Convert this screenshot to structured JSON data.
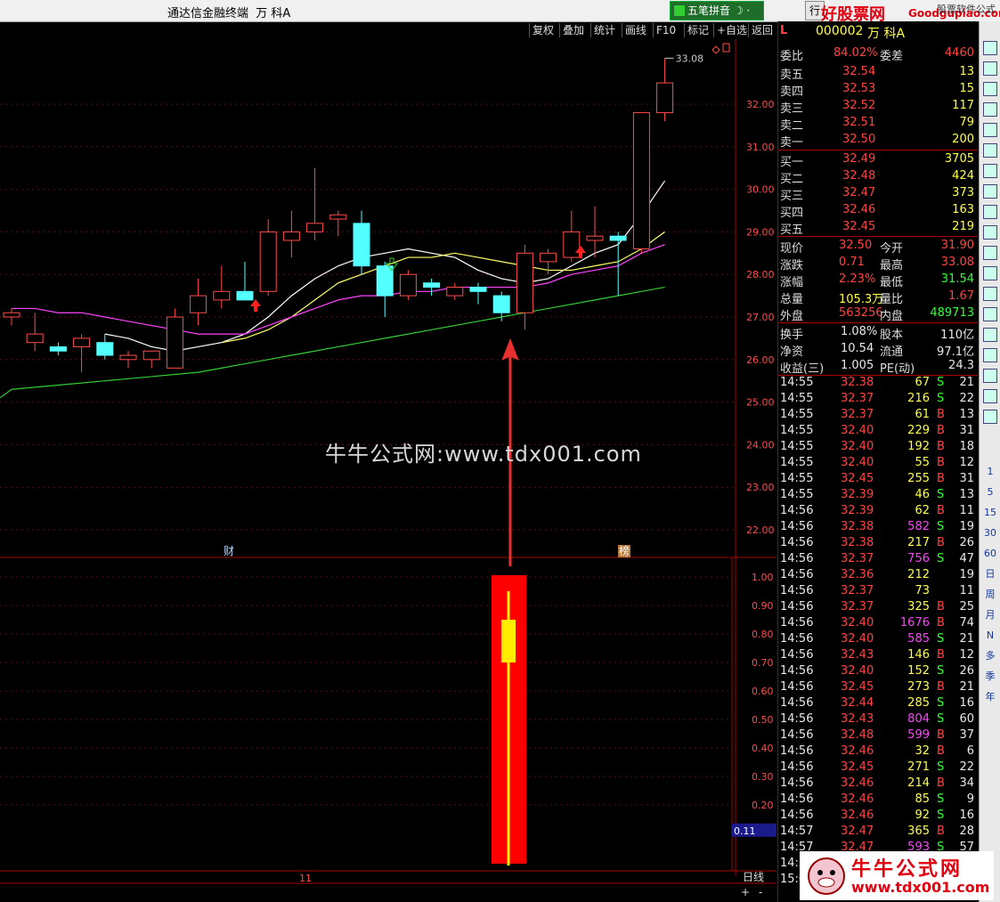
{
  "window": {
    "title": "通达信金融终端",
    "stock_name": "万 科A"
  },
  "top_right": {
    "formula_btn": "五笔拼音",
    "hang_label": "行",
    "brand": "好股票网",
    "brand_url": "Goodgupiao.com",
    "brand_sub": "股票软件公式"
  },
  "toolbar": {
    "items": [
      "复权",
      "叠加",
      "统计",
      "画线",
      "F10",
      "标记",
      "+自选",
      "返回"
    ]
  },
  "chart_data": [
    {
      "type": "candlestick",
      "title": "",
      "ylim": [
        21.5,
        33.3
      ],
      "yticks": [
        22.0,
        23.0,
        24.0,
        25.0,
        26.0,
        27.0,
        28.0,
        29.0,
        30.0,
        31.0,
        32.0
      ],
      "max_label": "33.08",
      "candles": [
        [
          27.0,
          27.2,
          26.8,
          27.1
        ],
        [
          26.4,
          27.1,
          26.2,
          26.6
        ],
        [
          26.3,
          26.4,
          26.1,
          26.2
        ],
        [
          26.3,
          26.6,
          25.7,
          26.5
        ],
        [
          26.4,
          26.6,
          26.0,
          26.1
        ],
        [
          26.0,
          26.2,
          25.8,
          26.1
        ],
        [
          26.0,
          26.2,
          25.8,
          26.2
        ],
        [
          25.8,
          27.2,
          25.8,
          27.0
        ],
        [
          27.1,
          27.9,
          26.8,
          27.5
        ],
        [
          27.4,
          28.2,
          27.2,
          27.6
        ],
        [
          27.6,
          28.3,
          27.5,
          27.4
        ],
        [
          27.6,
          29.3,
          27.5,
          29.0
        ],
        [
          28.8,
          29.5,
          28.4,
          29.0
        ],
        [
          29.0,
          30.5,
          28.8,
          29.2
        ],
        [
          29.3,
          29.5,
          28.9,
          29.4
        ],
        [
          29.2,
          29.5,
          28.0,
          28.2
        ],
        [
          28.2,
          28.3,
          27.0,
          27.5
        ],
        [
          27.5,
          28.1,
          27.4,
          28.0
        ],
        [
          27.8,
          27.9,
          27.5,
          27.7
        ],
        [
          27.5,
          27.8,
          27.4,
          27.7
        ],
        [
          27.7,
          27.8,
          27.3,
          27.6
        ],
        [
          27.5,
          27.6,
          26.9,
          27.1
        ],
        [
          27.1,
          28.7,
          26.7,
          28.5
        ],
        [
          28.3,
          28.6,
          28.0,
          28.5
        ],
        [
          28.4,
          29.5,
          28.3,
          29.0
        ],
        [
          28.8,
          29.6,
          28.4,
          28.9
        ],
        [
          28.9,
          29.0,
          27.5,
          28.8
        ],
        [
          28.6,
          31.8,
          28.5,
          31.8
        ],
        [
          31.8,
          33.08,
          31.6,
          32.5
        ]
      ],
      "ma_series": [
        {
          "color": "#ffffff",
          "values": [
            null,
            null,
            null,
            null,
            26.6,
            26.5,
            26.3,
            26.2,
            26.3,
            26.4,
            26.6,
            27.0,
            27.5,
            27.9,
            28.2,
            28.4,
            28.5,
            28.6,
            28.5,
            28.4,
            28.1,
            27.9,
            27.8,
            27.9,
            28.2,
            28.5,
            28.7,
            29.4,
            30.2
          ]
        },
        {
          "color": "#ffff66",
          "values": [
            null,
            null,
            null,
            null,
            null,
            null,
            null,
            null,
            null,
            26.4,
            26.5,
            26.7,
            27.0,
            27.4,
            27.8,
            28.0,
            28.2,
            28.4,
            28.4,
            28.5,
            28.4,
            28.3,
            28.2,
            28.1,
            28.1,
            28.2,
            28.3,
            28.6,
            29.0
          ]
        },
        {
          "color": "#ff44ff",
          "values": [
            27.2,
            27.2,
            27.1,
            27.1,
            27.0,
            26.9,
            26.8,
            26.7,
            26.6,
            26.6,
            26.6,
            26.8,
            27.0,
            27.2,
            27.4,
            27.5,
            27.5,
            27.6,
            27.6,
            27.7,
            27.7,
            27.7,
            27.7,
            27.8,
            28.0,
            28.1,
            28.2,
            28.5,
            28.7
          ]
        },
        {
          "color": "#33cc33",
          "values": [
            25.3,
            25.35,
            25.4,
            25.45,
            25.5,
            25.55,
            25.6,
            25.65,
            25.7,
            25.8,
            25.9,
            26.0,
            26.1,
            26.2,
            26.3,
            26.4,
            26.5,
            26.6,
            26.7,
            26.8,
            26.9,
            27.0,
            27.1,
            27.2,
            27.3,
            27.4,
            27.5,
            27.6,
            27.7
          ]
        }
      ],
      "markers": [
        {
          "label": "财"
        },
        {
          "label": "榜"
        }
      ]
    },
    {
      "type": "bar",
      "ylim": [
        0.05,
        1.05
      ],
      "yticks": [
        0.2,
        0.3,
        0.4,
        0.5,
        0.6,
        0.7,
        0.8,
        0.9,
        1.0
      ],
      "current_value": "0.11",
      "signal_bar": {
        "bottom": 0.0,
        "top": 1.0,
        "inner_low": 0.7,
        "inner_high": 0.85
      }
    }
  ],
  "bottom_axis": {
    "label": "11",
    "period": "日线",
    "plus": "+",
    "minus": "-"
  },
  "watermark": "牛牛公式网:www.tdx001.com",
  "quote": {
    "code": "000002",
    "name": "万 科A",
    "tag": "L",
    "ratio_label": "委比",
    "ratio": "84.02%",
    "diff_label": "委差",
    "diff": "4460",
    "asks": [
      {
        "label": "卖五",
        "price": "32.54",
        "vol": "13"
      },
      {
        "label": "卖四",
        "price": "32.53",
        "vol": "15"
      },
      {
        "label": "卖三",
        "price": "32.52",
        "vol": "117"
      },
      {
        "label": "卖二",
        "price": "32.51",
        "vol": "79"
      },
      {
        "label": "卖一",
        "price": "32.50",
        "vol": "200"
      }
    ],
    "bids": [
      {
        "label": "买一",
        "price": "32.49",
        "vol": "3705"
      },
      {
        "label": "买二",
        "price": "32.48",
        "vol": "424"
      },
      {
        "label": "买三",
        "price": "32.47",
        "vol": "373"
      },
      {
        "label": "买四",
        "price": "32.46",
        "vol": "163"
      },
      {
        "label": "买五",
        "price": "32.45",
        "vol": "219"
      }
    ],
    "stats": [
      {
        "l1": "现价",
        "v1": "32.50",
        "l2": "今开",
        "v2": "31.90"
      },
      {
        "l1": "涨跌",
        "v1": "0.71",
        "l2": "最高",
        "v2": "33.08"
      },
      {
        "l1": "涨幅",
        "v1": "2.23%",
        "l2": "最低",
        "v2": "31.54"
      },
      {
        "l1": "总量",
        "v1": "105.3万",
        "l2": "量比",
        "v2": "1.67"
      },
      {
        "l1": "外盘",
        "v1": "563256",
        "l2": "内盘",
        "v2": "489713"
      }
    ],
    "fund": [
      {
        "l1": "换手",
        "v1": "1.08%",
        "l2": "股本",
        "v2": "110亿"
      },
      {
        "l1": "净资",
        "v1": "10.54",
        "l2": "流通",
        "v2": "97.1亿"
      },
      {
        "l1": "收益(三)",
        "v1": "1.005",
        "l2": "PE(动)",
        "v2": "24.3"
      }
    ]
  },
  "ticks": [
    [
      "14:55",
      "32.38",
      "67",
      "S",
      "21"
    ],
    [
      "14:55",
      "32.37",
      "216",
      "S",
      "22"
    ],
    [
      "14:55",
      "32.37",
      "61",
      "B",
      "13"
    ],
    [
      "14:55",
      "32.40",
      "229",
      "B",
      "31"
    ],
    [
      "14:55",
      "32.40",
      "192",
      "B",
      "18"
    ],
    [
      "14:55",
      "32.40",
      "55",
      "B",
      "12"
    ],
    [
      "14:55",
      "32.45",
      "255",
      "B",
      "31"
    ],
    [
      "14:55",
      "32.39",
      "46",
      "S",
      "13"
    ],
    [
      "14:56",
      "32.39",
      "62",
      "B",
      "11"
    ],
    [
      "14:56",
      "32.38",
      "582",
      "S",
      "19"
    ],
    [
      "14:56",
      "32.38",
      "217",
      "B",
      "26"
    ],
    [
      "14:56",
      "32.37",
      "756",
      "S",
      "47"
    ],
    [
      "14:56",
      "32.36",
      "212",
      "",
      "19"
    ],
    [
      "14:56",
      "32.37",
      "73",
      "",
      "11"
    ],
    [
      "14:56",
      "32.37",
      "325",
      "B",
      "25"
    ],
    [
      "14:56",
      "32.40",
      "1676",
      "B",
      "74"
    ],
    [
      "14:56",
      "32.40",
      "585",
      "S",
      "21"
    ],
    [
      "14:56",
      "32.43",
      "146",
      "B",
      "12"
    ],
    [
      "14:56",
      "32.40",
      "152",
      "S",
      "26"
    ],
    [
      "14:56",
      "32.45",
      "273",
      "B",
      "21"
    ],
    [
      "14:56",
      "32.44",
      "285",
      "S",
      "16"
    ],
    [
      "14:56",
      "32.43",
      "804",
      "S",
      "60"
    ],
    [
      "14:56",
      "32.48",
      "599",
      "B",
      "37"
    ],
    [
      "14:56",
      "32.46",
      "32",
      "B",
      "6"
    ],
    [
      "14:56",
      "32.45",
      "271",
      "S",
      "22"
    ],
    [
      "14:56",
      "32.46",
      "214",
      "B",
      "34"
    ],
    [
      "14:56",
      "32.46",
      "85",
      "S",
      "9"
    ],
    [
      "14:56",
      "32.46",
      "92",
      "S",
      "16"
    ],
    [
      "14:57",
      "32.47",
      "365",
      "B",
      "28"
    ],
    [
      "14:57",
      "32.47",
      "593",
      "S",
      "57"
    ],
    [
      "14:57",
      "",
      "",
      "",
      ""
    ],
    [
      "15:00",
      "",
      "",
      "",
      ""
    ]
  ],
  "sidebar_labels": [
    "1",
    "5",
    "15",
    "30",
    "60",
    "日",
    "周",
    "月",
    "N",
    "多",
    "季",
    "年"
  ],
  "sidebar_icons": [
    "up-arrow-icon",
    "down-arrow-icon",
    "quote-icon",
    "table-icon",
    "line-chart-icon",
    "candle-icon",
    "grid-icon",
    "f10-icon",
    "calendar-icon",
    "fundamental-icon",
    "fx-icon",
    "clock-icon",
    "circle-icon",
    "wave-icon",
    "rsi-icon",
    "move-icon",
    "pen-icon",
    "f5-icon",
    "refresh-icon"
  ],
  "bottom_logo": {
    "text": "牛牛公式网",
    "url": "www.tdx001.com"
  }
}
